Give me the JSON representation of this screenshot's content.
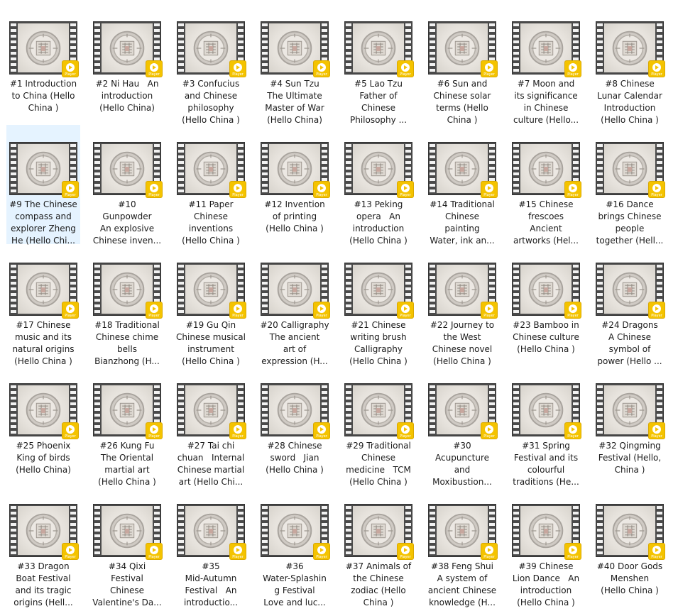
{
  "badge_text": "Player",
  "selected_index": 8,
  "colors": {
    "selection": "#e5f3ff",
    "badge": "#f4c300"
  },
  "files": [
    {
      "label": "#1 Introduction\nto China (Hello\nChina )"
    },
    {
      "label": "#2 Ni Hau   An\nintroduction\n(Hello China)"
    },
    {
      "label": "#3 Confucius\nand Chinese\nphilosophy\n(Hello China )"
    },
    {
      "label": "#4 Sun Tzu\nThe Ultimate\nMaster of War\n(Hello China)"
    },
    {
      "label": "#5 Lao Tzu\nFather of\nChinese\nPhilosophy ..."
    },
    {
      "label": "#6 Sun and\nChinese solar\nterms (Hello\nChina )"
    },
    {
      "label": "#7 Moon and\nits significance\nin Chinese\nculture (Hello..."
    },
    {
      "label": "#8 Chinese\nLunar Calendar\nIntroduction\n(Hello China )"
    },
    {
      "label": "#9 The Chinese\ncompass and\nexplorer Zheng\nHe (Hello Chi..."
    },
    {
      "label": "#10\nGunpowder\nAn explosive\nChinese inven..."
    },
    {
      "label": "#11 Paper\nChinese\ninventions\n(Hello China )"
    },
    {
      "label": "#12 Invention\nof printing\n(Hello China )"
    },
    {
      "label": "#13 Peking\nopera   An\nintroduction\n(Hello China )"
    },
    {
      "label": "#14 Traditional\nChinese\npainting\nWater, ink an..."
    },
    {
      "label": "#15 Chinese\nfrescoes\nAncient\nartworks (Hel..."
    },
    {
      "label": "#16 Dance\nbrings Chinese\npeople\ntogether (Hell..."
    },
    {
      "label": "#17 Chinese\nmusic and its\nnatural origins\n(Hello China )"
    },
    {
      "label": "#18 Traditional\nChinese chime\nbells\nBianzhong (H..."
    },
    {
      "label": "#19 Gu Qin\nChinese musical\ninstrument\n(Hello China )"
    },
    {
      "label": "#20 Calligraphy\nThe ancient\nart of\nexpression (H..."
    },
    {
      "label": "#21 Chinese\nwriting brush\nCalligraphy\n(Hello China )"
    },
    {
      "label": "#22 Journey to\nthe West\nChinese novel\n(Hello China )"
    },
    {
      "label": "#23 Bamboo in\nChinese culture\n(Hello China )"
    },
    {
      "label": "#24 Dragons\nA Chinese\nsymbol of\npower (Hello ..."
    },
    {
      "label": "#25 Phoenix\nKing of birds\n(Hello China)"
    },
    {
      "label": "#26 Kung Fu\nThe Oriental\nmartial art\n(Hello China )"
    },
    {
      "label": "#27 Tai chi\nchuan   Internal\nChinese martial\nart (Hello Chi..."
    },
    {
      "label": "#28 Chinese\nsword   Jian\n(Hello China )"
    },
    {
      "label": "#29 Traditional\nChinese\nmedicine   TCM\n(Hello China )"
    },
    {
      "label": "#30\nAcupuncture\nand\nMoxibustion..."
    },
    {
      "label": "#31 Spring\nFestival and its\ncolourful\ntraditions (He..."
    },
    {
      "label": "#32 Qingming\nFestival (Hello,\nChina )"
    },
    {
      "label": "#33 Dragon\nBoat Festival\nand its tragic\norigins (Hell..."
    },
    {
      "label": "#34 Qixi\nFestival\nChinese\nValentine's Da..."
    },
    {
      "label": "#35\nMid-Autumn\nFestival   An\nintroductio..."
    },
    {
      "label": "#36\nWater-Splashin\ng Festival\nLove and luc..."
    },
    {
      "label": "#37 Animals of\nthe Chinese\nzodiac (Hello\nChina )"
    },
    {
      "label": "#38 Feng Shui\nA system of\nancient Chinese\nknowledge (H..."
    },
    {
      "label": "#39 Chinese\nLion Dance   An\nintroduction\n(Hello China )"
    },
    {
      "label": "#40 Door Gods\nMenshen\n(Hello China )"
    }
  ]
}
